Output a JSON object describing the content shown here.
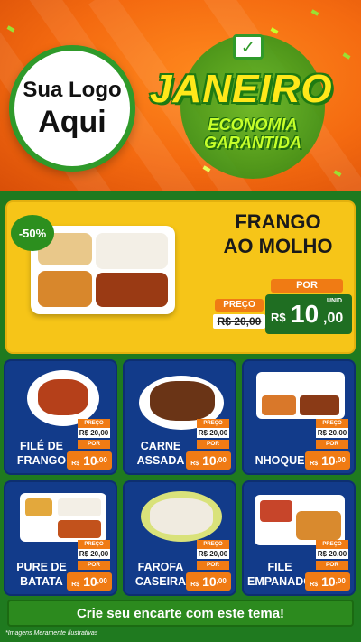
{
  "colors": {
    "header_orange": "#f46a10",
    "brand_green": "#2f9a2a",
    "yellow": "#f6c518",
    "card_blue": "#123b8a",
    "price_orange": "#f07b14",
    "dark_green": "#1f6e22"
  },
  "header": {
    "logo_line1": "Sua Logo",
    "logo_line2": "Aqui",
    "check_icon": "check-icon",
    "title": "JANEIRO",
    "subtitle_line1": "ECONOMIA",
    "subtitle_line2": "GARANTIDA"
  },
  "featured": {
    "discount": "-50%",
    "name_line1": "FRANGO",
    "name_line2": "AO MOLHO",
    "preco_label": "PREÇO",
    "old_price": "R$ 20,00",
    "por_label": "POR",
    "new_currency": "R$",
    "new_int": "10",
    "new_cents": ",00",
    "unid": "UNID"
  },
  "products": [
    {
      "name_line1": "FILÉ DE",
      "name_line2": "FRANGO",
      "preco": "PREÇO",
      "old": "R$ 20,00",
      "por": "POR",
      "currency": "R$",
      "int": "10",
      "cents": ",00",
      "unid": "UNID"
    },
    {
      "name_line1": "CARNE",
      "name_line2": "ASSADA",
      "preco": "PREÇO",
      "old": "R$ 20,00",
      "por": "POR",
      "currency": "R$",
      "int": "10",
      "cents": ",00",
      "unid": "UNID"
    },
    {
      "name_line1": "NHOQUE",
      "name_line2": "",
      "preco": "PREÇO",
      "old": "R$ 20,00",
      "por": "POR",
      "currency": "R$",
      "int": "10",
      "cents": ",00",
      "unid": "UNID"
    },
    {
      "name_line1": "PURE DE",
      "name_line2": "BATATA",
      "preco": "PREÇO",
      "old": "R$ 20,00",
      "por": "POR",
      "currency": "R$",
      "int": "10",
      "cents": ",00",
      "unid": "UNID"
    },
    {
      "name_line1": "FAROFA",
      "name_line2": "CASEIRA",
      "preco": "PREÇO",
      "old": "R$ 20,00",
      "por": "POR",
      "currency": "R$",
      "int": "10",
      "cents": ",00",
      "unid": "UNID"
    },
    {
      "name_line1": "FILE",
      "name_line2": "EMPANADO",
      "preco": "PREÇO",
      "old": "R$ 20,00",
      "por": "POR",
      "currency": "R$",
      "int": "10",
      "cents": ",00",
      "unid": "UNID"
    }
  ],
  "cta": "Crie seu encarte com este tema!",
  "footer_note": "*Imagens Meramente Ilustrativas"
}
